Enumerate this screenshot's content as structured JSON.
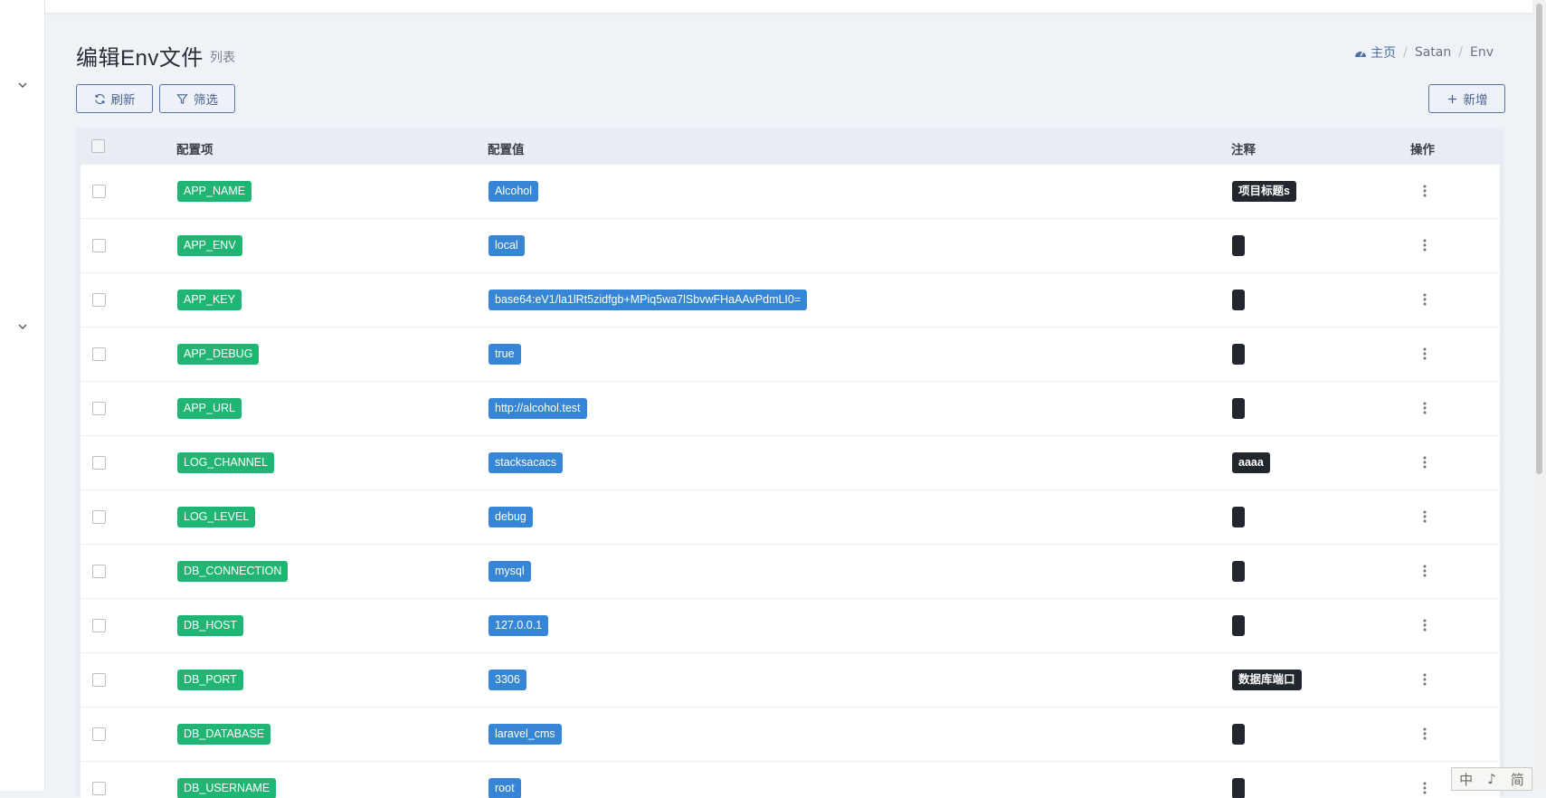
{
  "page": {
    "title": "编辑Env文件",
    "subtitle": "列表"
  },
  "breadcrumb": {
    "home": "主页",
    "items": [
      "Satan",
      "Env"
    ],
    "separator": "/"
  },
  "toolbar": {
    "refresh_label": "刷新",
    "filter_label": "筛选",
    "add_label": "新增"
  },
  "table": {
    "columns": [
      "配置项",
      "配置值",
      "注释",
      "操作"
    ],
    "rows": [
      {
        "key": "APP_NAME",
        "value": "Alcohol",
        "note": "项目标题s"
      },
      {
        "key": "APP_ENV",
        "value": "local",
        "note": ""
      },
      {
        "key": "APP_KEY",
        "value": "base64:eV1/la1lRt5zidfgb+MPiq5wa7lSbvwFHaAAvPdmLI0=",
        "note": ""
      },
      {
        "key": "APP_DEBUG",
        "value": "true",
        "note": ""
      },
      {
        "key": "APP_URL",
        "value": "http://alcohol.test",
        "note": ""
      },
      {
        "key": "LOG_CHANNEL",
        "value": "stacksacacs",
        "note": "aaaa"
      },
      {
        "key": "LOG_LEVEL",
        "value": "debug",
        "note": ""
      },
      {
        "key": "DB_CONNECTION",
        "value": "mysql",
        "note": ""
      },
      {
        "key": "DB_HOST",
        "value": "127.0.0.1",
        "note": ""
      },
      {
        "key": "DB_PORT",
        "value": "3306",
        "note": "数据库端口"
      },
      {
        "key": "DB_DATABASE",
        "value": "laravel_cms",
        "note": ""
      },
      {
        "key": "DB_USERNAME",
        "value": "root",
        "note": ""
      }
    ]
  },
  "ime_bar": {
    "chars": [
      "中",
      "♪",
      "简"
    ]
  },
  "colors": {
    "key_tag": "#21b573",
    "value_tag": "#3685d6",
    "note_tag": "#22262d",
    "button_border": "#5a74a6"
  },
  "icons": {
    "refresh": "refresh-icon",
    "filter": "filter-icon",
    "add": "plus-icon",
    "home": "dashboard-icon",
    "row_actions": "more-vertical-icon"
  }
}
